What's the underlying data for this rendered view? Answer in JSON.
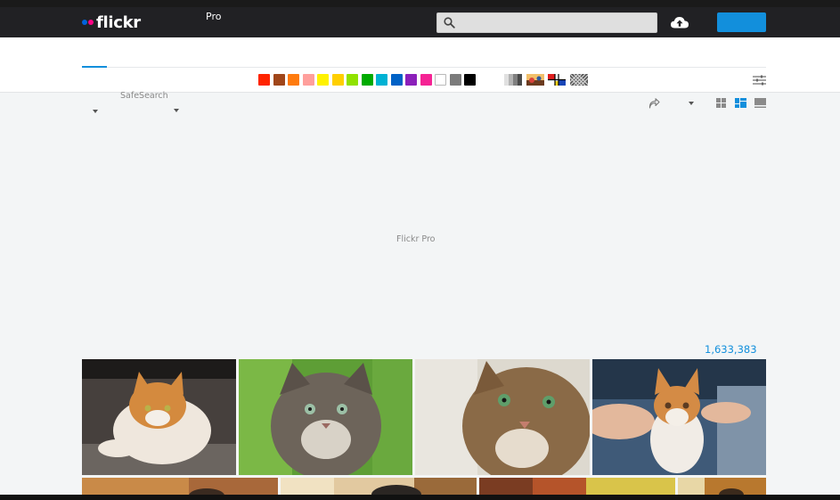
{
  "header": {
    "logo_text": "flickr",
    "pro_link": "Pro",
    "search_placeholder": "",
    "signup_label": "",
    "brand_colors": {
      "blue": "#0063dc",
      "pink": "#ff0084",
      "accent": "#128fdc"
    }
  },
  "subnav": {
    "active_tab_label": "",
    "color_swatches": [
      "#ff2400",
      "#a0461a",
      "#ff7b0e",
      "#ff9f9c",
      "#fff200",
      "#ffcf00",
      "#90e200",
      "#00ab00",
      "#00b2d4",
      "#0062c6",
      "#8c20ba",
      "#f52394",
      "#ffffff",
      "#7b7b7b",
      "#000000"
    ],
    "style_filters": [
      "black-and-white",
      "shallow-depth-of-field",
      "minimalist",
      "patterns"
    ]
  },
  "toolbar": {
    "safesearch_label": "SafeSearch",
    "view_modes": [
      "grid-view",
      "justified-view",
      "list-view"
    ],
    "active_view": "justified-view"
  },
  "promo": {
    "text": "Flickr Pro"
  },
  "results": {
    "count": "1,633,383"
  },
  "photos": [
    {
      "name": "orange-white-cat-under-car"
    },
    {
      "name": "longhair-tabby-on-grass"
    },
    {
      "name": "tabby-cat-closeup"
    },
    {
      "name": "kitten-held-by-child"
    },
    {
      "name": "cat-photo-row2-a"
    },
    {
      "name": "cat-photo-row2-b"
    },
    {
      "name": "cat-photo-row2-c"
    },
    {
      "name": "cat-photo-row2-d"
    }
  ]
}
